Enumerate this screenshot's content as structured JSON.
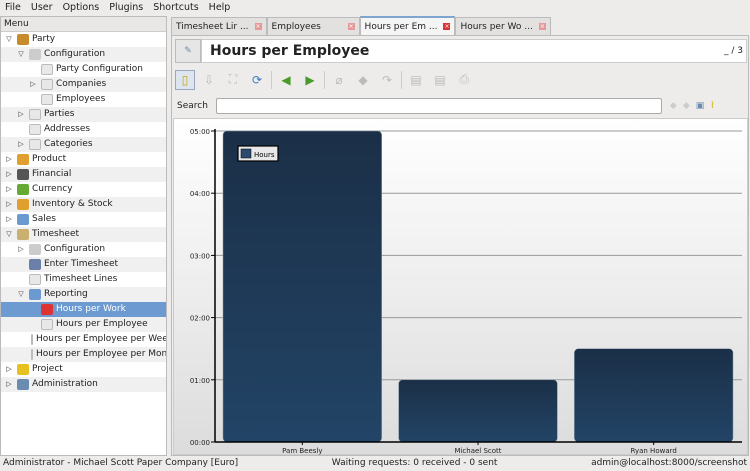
{
  "menubar": [
    "File",
    "User",
    "Options",
    "Plugins",
    "Shortcuts",
    "Help"
  ],
  "sidebar": {
    "header": "Menu",
    "items": [
      {
        "label": "Party",
        "depth": 0,
        "tri": "down",
        "icon": "party-icon",
        "color": "#c78b2c"
      },
      {
        "label": "Configuration",
        "depth": 1,
        "tri": "down",
        "icon": "configuration-icon",
        "color": "#ccc"
      },
      {
        "label": "Party Configuration",
        "depth": 2,
        "tri": "",
        "icon": "document-icon"
      },
      {
        "label": "Companies",
        "depth": 2,
        "tri": "right",
        "icon": "document-icon"
      },
      {
        "label": "Employees",
        "depth": 2,
        "tri": "",
        "icon": "document-icon"
      },
      {
        "label": "Parties",
        "depth": 1,
        "tri": "right",
        "icon": "document-icon"
      },
      {
        "label": "Addresses",
        "depth": 1,
        "tri": "",
        "icon": "document-icon"
      },
      {
        "label": "Categories",
        "depth": 1,
        "tri": "right",
        "icon": "document-icon"
      },
      {
        "label": "Product",
        "depth": 0,
        "tri": "right",
        "icon": "product-icon",
        "color": "#e0a030"
      },
      {
        "label": "Financial",
        "depth": 0,
        "tri": "right",
        "icon": "calculator-icon",
        "color": "#555"
      },
      {
        "label": "Currency",
        "depth": 0,
        "tri": "right",
        "icon": "currency-icon",
        "color": "#6a3"
      },
      {
        "label": "Inventory & Stock",
        "depth": 0,
        "tri": "right",
        "icon": "inventory-icon",
        "color": "#e0a030"
      },
      {
        "label": "Sales",
        "depth": 0,
        "tri": "right",
        "icon": "sales-icon",
        "color": "#6a9ad0"
      },
      {
        "label": "Timesheet",
        "depth": 0,
        "tri": "down",
        "icon": "clock-icon",
        "color": "#c9b070"
      },
      {
        "label": "Configuration",
        "depth": 1,
        "tri": "right",
        "icon": "configuration-icon",
        "color": "#ccc"
      },
      {
        "label": "Enter Timesheet",
        "depth": 1,
        "tri": "",
        "icon": "diamond-icon",
        "color": "#6a80a8"
      },
      {
        "label": "Timesheet Lines",
        "depth": 1,
        "tri": "",
        "icon": "document-icon"
      },
      {
        "label": "Reporting",
        "depth": 1,
        "tri": "down",
        "icon": "folder-icon",
        "color": "#6a9ad0"
      },
      {
        "label": "Hours per Work",
        "depth": 2,
        "tri": "",
        "icon": "chart-icon",
        "color": "#d33",
        "selected": true
      },
      {
        "label": "Hours per Employee",
        "depth": 2,
        "tri": "",
        "icon": "document-icon"
      },
      {
        "label": "Hours per Employee per Week",
        "depth": 2,
        "tri": "",
        "icon": "document-icon"
      },
      {
        "label": "Hours per Employee per Month",
        "depth": 2,
        "tri": "",
        "icon": "document-icon"
      },
      {
        "label": "Project",
        "depth": 0,
        "tri": "right",
        "icon": "project-icon",
        "color": "#e8c020"
      },
      {
        "label": "Administration",
        "depth": 0,
        "tri": "right",
        "icon": "tools-icon",
        "color": "#6a8cb0"
      }
    ]
  },
  "tabs": [
    {
      "label": "Timesheet Lir ...",
      "active": false
    },
    {
      "label": "Employees",
      "active": false
    },
    {
      "label": "Hours per Em ...",
      "active": true
    },
    {
      "label": "Hours per Wo ...",
      "active": false
    }
  ],
  "view": {
    "title": "Hours per Employee",
    "record_count": "_ / 3",
    "search_label": "Search",
    "search_value": ""
  },
  "chart_data": {
    "type": "bar",
    "categories": [
      "Pam Beesly",
      "Michael Scott",
      "Ryan Howard"
    ],
    "series": [
      {
        "name": "Hours",
        "values": [
          5,
          1,
          1.5
        ]
      }
    ],
    "ylim": [
      0,
      5
    ],
    "yticks": [
      "00:00",
      "01:00",
      "02:00",
      "03:00",
      "04:00",
      "05:00"
    ],
    "legend": "top-left",
    "color": "#1f3b5a",
    "grid": true
  },
  "status": {
    "left": "Administrator - Michael Scott Paper Company [Euro]",
    "center": "Waiting requests: 0 received - 0 sent",
    "right": "admin@localhost:8000/screenshot"
  }
}
